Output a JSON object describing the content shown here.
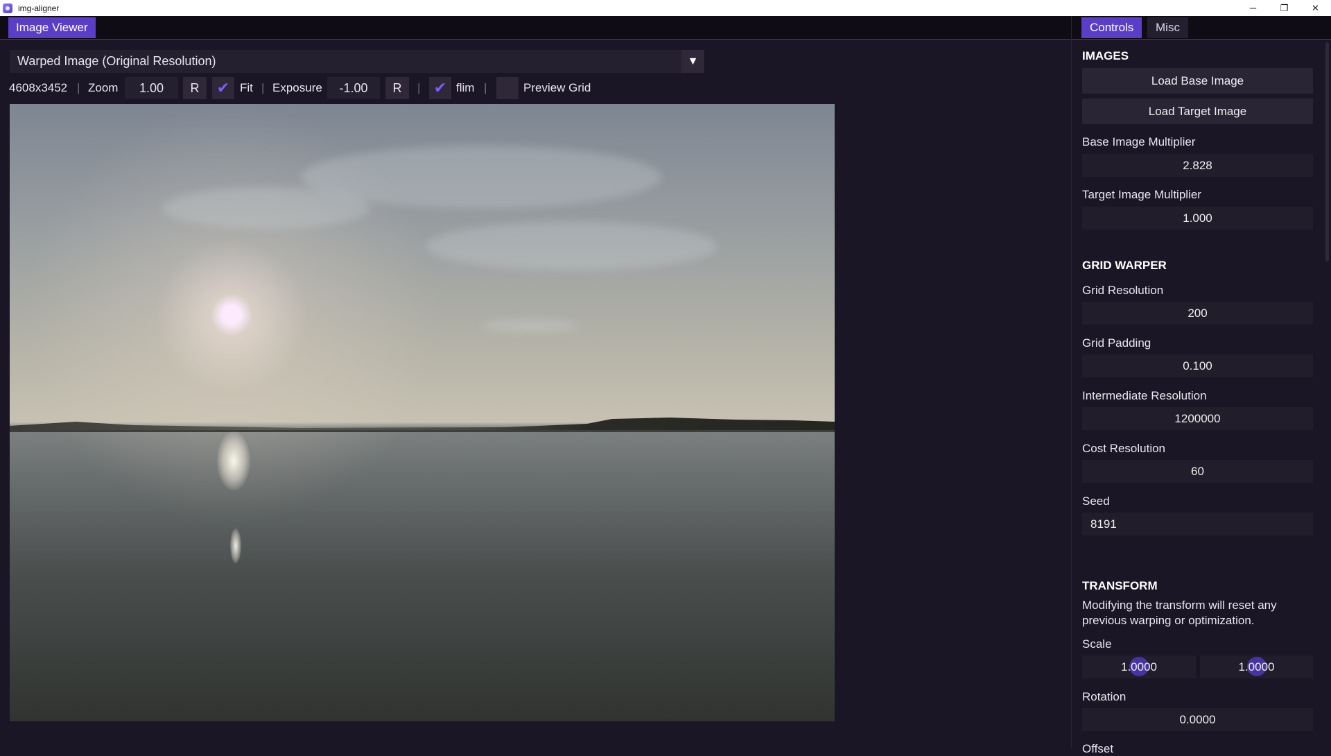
{
  "window": {
    "title": "img-aligner",
    "controls": {
      "minimize": "─",
      "restore": "❐",
      "close": "✕"
    }
  },
  "viewer": {
    "tab_label": "Image Viewer",
    "view_select": "Warped Image (Original Resolution)",
    "dropdown_arrow": "▼",
    "resolution": "4608x3452",
    "zoom_label": "Zoom",
    "zoom_value": "1.00",
    "reset_label": "R",
    "fit_label": "Fit",
    "fit_checked": true,
    "exposure_label": "Exposure",
    "exposure_value": "-1.00",
    "flim_label": "flim",
    "flim_checked": true,
    "preview_grid_label": "Preview Grid",
    "preview_grid_checked": false,
    "separator": "|",
    "check_glyph": "✔"
  },
  "panel": {
    "tabs": [
      "Controls",
      "Misc"
    ],
    "active_tab": "Controls",
    "images": {
      "heading": "IMAGES",
      "load_base": "Load Base Image",
      "load_target": "Load Target Image",
      "base_mult_label": "Base Image Multiplier",
      "base_mult_value": "2.828",
      "target_mult_label": "Target Image Multiplier",
      "target_mult_value": "1.000"
    },
    "grid_warper": {
      "heading": "GRID WARPER",
      "grid_res_label": "Grid Resolution",
      "grid_res_value": "200",
      "grid_pad_label": "Grid Padding",
      "grid_pad_value": "0.100",
      "inter_res_label": "Intermediate Resolution",
      "inter_res_value": "1200000",
      "cost_res_label": "Cost Resolution",
      "cost_res_value": "60",
      "seed_label": "Seed",
      "seed_value": "8191"
    },
    "transform": {
      "heading": "TRANSFORM",
      "note_line1": "Modifying the transform will reset any",
      "note_line2": "previous warping or optimization.",
      "scale_label": "Scale",
      "scale_x": "1.0000",
      "scale_y": "1.0000",
      "rotation_label": "Rotation",
      "rotation_value": "0.0000",
      "offset_label": "Offset"
    }
  },
  "colors": {
    "accent": "#5a3ec8",
    "background": "#1a1625",
    "field": "#221d2b",
    "check": "#7b5cff"
  }
}
